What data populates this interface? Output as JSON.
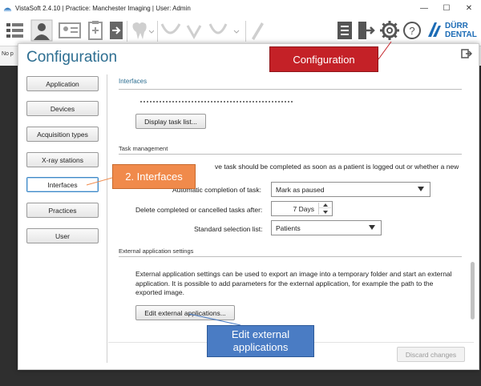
{
  "window": {
    "title": "VistaSoft 2.4.10 | Practice: Manchester Imaging | User: Admin",
    "minimize": "—",
    "maximize": "☐",
    "close": "✕"
  },
  "toolbar": {
    "brand_top": "DÜRR",
    "brand_bottom": "DENTAL",
    "icons": [
      "list-view-icon",
      "patient-icon",
      "patient-card-icon",
      "clipboard-icon",
      "patient-import-icon",
      "tooth-icon",
      "curve-tool-icon",
      "gear-icon",
      "help-icon"
    ]
  },
  "strip": {
    "text": "No p"
  },
  "dialog": {
    "title": "Configuration",
    "nav": [
      {
        "label": "Application"
      },
      {
        "label": "Devices"
      },
      {
        "label": "Acquisition types"
      },
      {
        "label": "X-ray stations"
      },
      {
        "label": "Interfaces"
      },
      {
        "label": "Practices"
      },
      {
        "label": "User"
      }
    ],
    "active_nav": "Interfaces"
  },
  "content": {
    "header": "Interfaces",
    "display_task_list_button": "Display task list...",
    "task_management": {
      "heading": "Task management",
      "description_partial": "ve task should be completed as soon as a patient is logged out or whether a new",
      "auto_completion_label": "Automatic completion of task:",
      "auto_completion_value": "Mark as paused",
      "delete_after_label": "Delete completed or cancelled tasks after:",
      "delete_after_value": "7 Days",
      "standard_list_label": "Standard selection list:",
      "standard_list_value": "Patients"
    },
    "external_apps": {
      "heading": "External application settings",
      "description": "External application settings can be used to export an image into a temporary folder and start an external application. It is possible to add parameters for the external application, for example the path to the exported image.",
      "edit_button": "Edit external applications..."
    },
    "discard_button": "Discard changes"
  },
  "callouts": {
    "configuration": "Configuration",
    "interfaces": "2. Interfaces",
    "edit_external_line1": "Edit external",
    "edit_external_line2": "applications"
  },
  "colors": {
    "title_blue": "#2d6e91",
    "callout_red": "#c42127",
    "callout_orange": "#f08a4b",
    "callout_blue": "#4a7cc4",
    "brand_blue": "#1b6bb5"
  }
}
